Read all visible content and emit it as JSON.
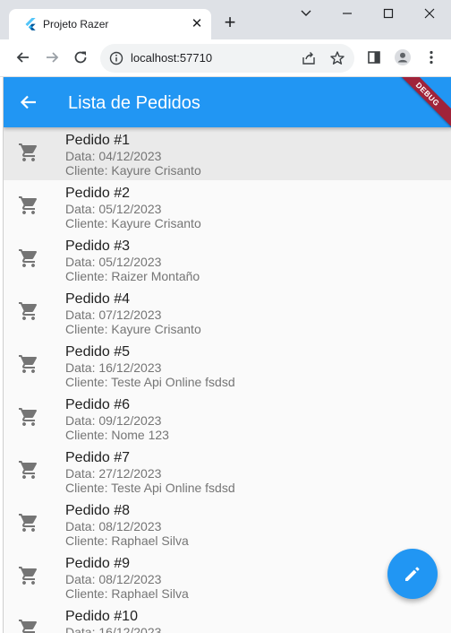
{
  "browser": {
    "tab_title": "Projeto Razer",
    "url": "localhost:57710"
  },
  "icons": {
    "favicon": "flutter-logo-icon",
    "tab_close": "close-icon",
    "new_tab": "plus-icon",
    "back": "arrow-left-icon",
    "forward": "arrow-right-icon",
    "reload": "reload-icon",
    "site_info": "info-icon",
    "share": "share-icon",
    "bookmark": "star-icon",
    "side_panel": "side-panel-icon",
    "profile": "profile-icon",
    "menu": "more-vert-icon",
    "cart": "shopping-cart-icon",
    "fab": "edit-pencil-icon"
  },
  "colors": {
    "primary": "#2196f3",
    "debug_banner": "#a0233a"
  },
  "app": {
    "title": "Lista de Pedidos",
    "debug_banner": "DEBUG",
    "orders": [
      {
        "title": "Pedido #1",
        "date": "Data: 04/12/2023",
        "client": "Cliente: Kayure Crisanto"
      },
      {
        "title": "Pedido #2",
        "date": "Data: 05/12/2023",
        "client": "Cliente: Kayure Crisanto"
      },
      {
        "title": "Pedido #3",
        "date": "Data: 05/12/2023",
        "client": "Cliente: Raizer  Montaño"
      },
      {
        "title": "Pedido #4",
        "date": "Data: 07/12/2023",
        "client": "Cliente: Kayure Crisanto"
      },
      {
        "title": "Pedido #5",
        "date": "Data: 16/12/2023",
        "client": "Cliente: Teste Api Online fsdsd"
      },
      {
        "title": "Pedido #6",
        "date": "Data: 09/12/2023",
        "client": "Cliente: Nome  123"
      },
      {
        "title": "Pedido #7",
        "date": "Data: 27/12/2023",
        "client": "Cliente: Teste Api Online fsdsd"
      },
      {
        "title": "Pedido #8",
        "date": "Data: 08/12/2023",
        "client": "Cliente: Raphael Silva"
      },
      {
        "title": "Pedido #9",
        "date": "Data: 08/12/2023",
        "client": "Cliente: Raphael Silva"
      },
      {
        "title": "Pedido #10",
        "date": "Data: 16/12/2023",
        "client": ""
      }
    ]
  }
}
